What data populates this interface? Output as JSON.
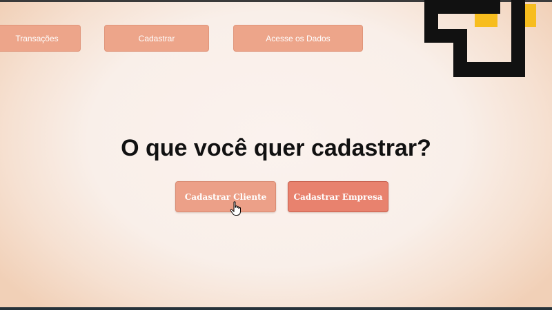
{
  "nav": {
    "items": [
      {
        "label": "Transações"
      },
      {
        "label": "Cadastrar"
      },
      {
        "label": "Acesse os Dados"
      }
    ]
  },
  "main": {
    "title": "O que você quer cadastrar?",
    "buttons": {
      "cliente": "Cadastrar Cliente",
      "empresa": "Cadastrar Empresa"
    }
  },
  "colors": {
    "nav_button": "#eda58a",
    "primary_button": "#e8826e",
    "hover_button": "#eca088",
    "logo_black": "#111111",
    "logo_yellow": "#f7bd1e"
  },
  "icons": {
    "logo": "logo-icon",
    "cursor": "hand-pointer-icon"
  }
}
